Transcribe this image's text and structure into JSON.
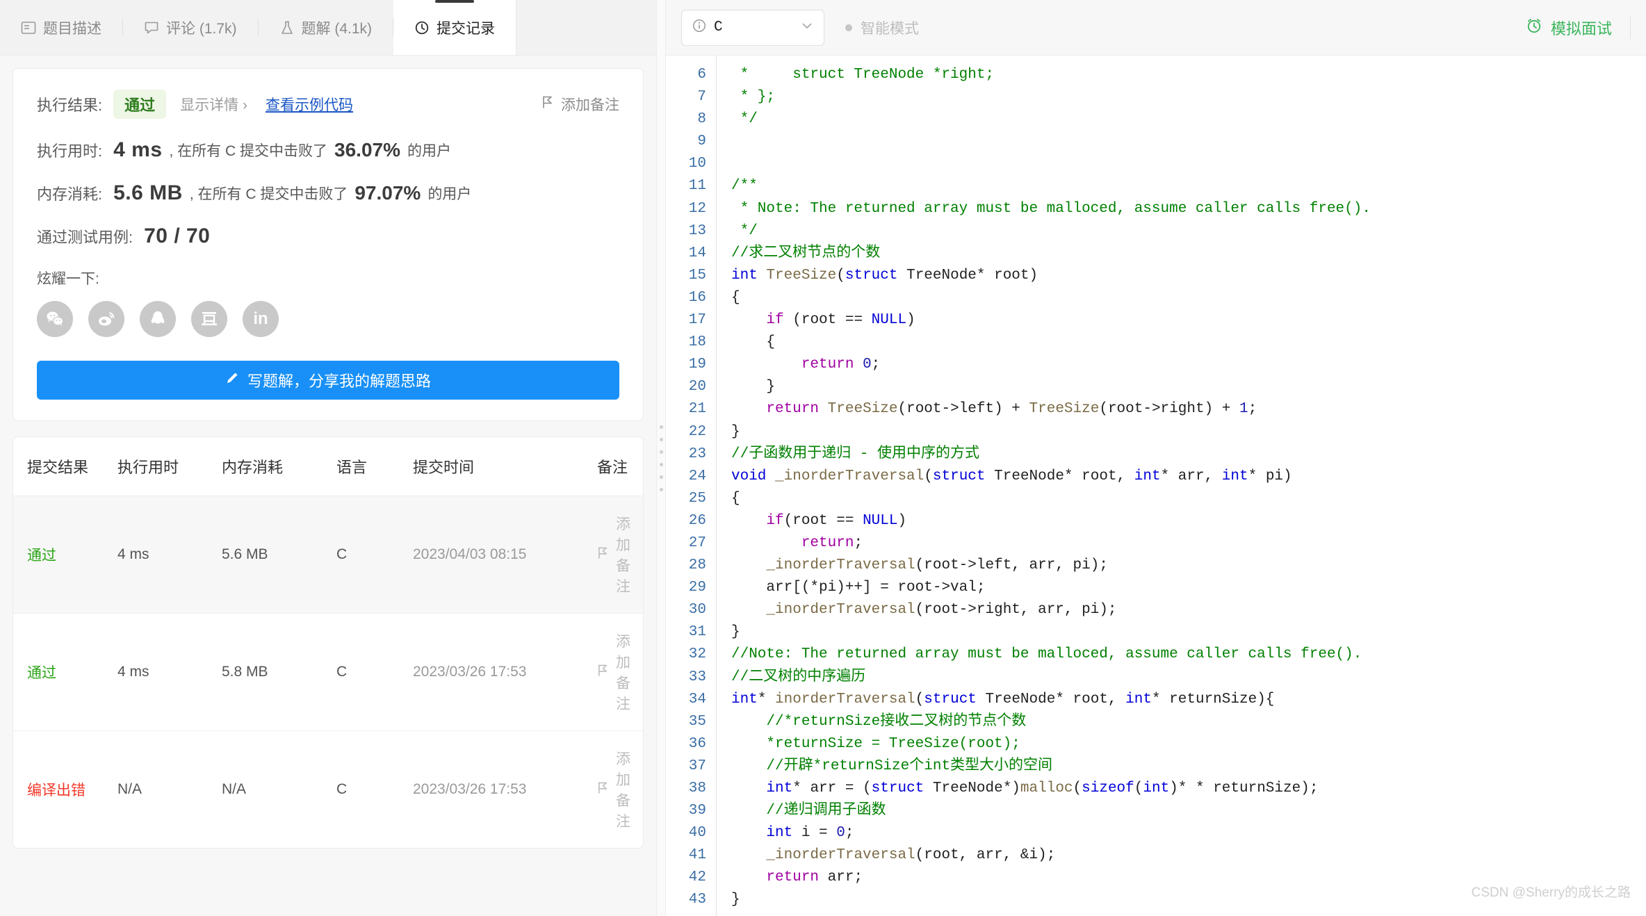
{
  "tabs": [
    {
      "label": "题目描述",
      "icon": "description-icon",
      "active": false
    },
    {
      "label": "评论 (1.7k)",
      "icon": "comment-icon",
      "active": false
    },
    {
      "label": "题解 (4.1k)",
      "icon": "flask-icon",
      "active": false
    },
    {
      "label": "提交记录",
      "icon": "clock-icon",
      "active": true
    }
  ],
  "result": {
    "exec_result_label": "执行结果:",
    "status": "通过",
    "show_detail": "显示详情 ›",
    "view_sample_code": "查看示例代码",
    "add_note": "添加备注",
    "runtime_label": "执行用时:",
    "runtime_value": "4 ms",
    "runtime_prefix": ", 在所有 C 提交中击败了",
    "runtime_pct": "36.07%",
    "runtime_suffix": "的用户",
    "memory_label": "内存消耗:",
    "memory_value": "5.6 MB",
    "memory_prefix": ", 在所有 C 提交中击败了",
    "memory_pct": "97.07%",
    "memory_suffix": "的用户",
    "testcase_label": "通过测试用例:",
    "testcase_value": "70 / 70",
    "share_label": "炫耀一下:",
    "share_icons": [
      "wechat-icon",
      "weibo-icon",
      "qq-icon",
      "douban-icon",
      "linkedin-icon"
    ],
    "write_solution_button": "写题解，分享我的解题思路"
  },
  "table": {
    "headers": [
      "提交结果",
      "执行用时",
      "内存消耗",
      "语言",
      "提交时间",
      "备注"
    ],
    "rows": [
      {
        "status": "通过",
        "status_type": "ok",
        "runtime": "4 ms",
        "memory": "5.6 MB",
        "lang": "C",
        "time": "2023/04/03 08:15",
        "note": "添加备注"
      },
      {
        "status": "通过",
        "status_type": "ok",
        "runtime": "4 ms",
        "memory": "5.8 MB",
        "lang": "C",
        "time": "2023/03/26 17:53",
        "note": "添加备注"
      },
      {
        "status": "编译出错",
        "status_type": "err",
        "runtime": "N/A",
        "memory": "N/A",
        "lang": "C",
        "time": "2023/03/26 17:53",
        "note": "添加备注"
      }
    ]
  },
  "editor": {
    "language": "C",
    "smart_mode": "智能模式",
    "mock_interview": "模拟面试",
    "watermark": "CSDN @Sherry的成长之路",
    "first_line_number": 6,
    "lines": [
      " *     struct TreeNode *right;",
      " * };",
      " */",
      "",
      "",
      "/**",
      " * Note: The returned array must be malloced, assume caller calls free().",
      " */",
      "//求二叉树节点的个数",
      "int TreeSize(struct TreeNode* root)",
      "{",
      "    if (root == NULL)",
      "    {",
      "        return 0;",
      "    }",
      "    return TreeSize(root->left) + TreeSize(root->right) + 1;",
      "}",
      "//子函数用于递归 - 使用中序的方式",
      "void _inorderTraversal(struct TreeNode* root, int* arr, int* pi)",
      "{",
      "    if(root == NULL)",
      "        return;",
      "    _inorderTraversal(root->left, arr, pi);",
      "    arr[(*pi)++] = root->val;",
      "    _inorderTraversal(root->right, arr, pi);",
      "}",
      "//Note: The returned array must be malloced, assume caller calls free().",
      "//二叉树的中序遍历",
      "int* inorderTraversal(struct TreeNode* root, int* returnSize){",
      "    //*returnSize接收二叉树的节点个数",
      "    *returnSize = TreeSize(root);",
      "    //开辟*returnSize个int类型大小的空间",
      "    int* arr = (struct TreeNode*)malloc(sizeof(int)* * returnSize);",
      "    //递归调用子函数",
      "    int i = 0;",
      "    _inorderTraversal(root, arr, &i);",
      "    return arr;",
      "}"
    ]
  },
  "colors": {
    "accent_blue": "#1890f7",
    "pass_green": "#2aa515",
    "error_red": "#f0392b",
    "comment_green": "#008000",
    "keyword_blue": "#0000d8",
    "keyword_purple": "#a000a0"
  }
}
